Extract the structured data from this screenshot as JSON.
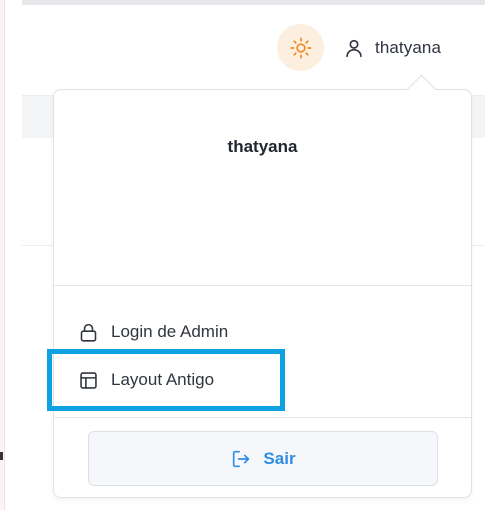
{
  "colors": {
    "accent": "#2f8de4",
    "highlight": "#0fa2e2",
    "theme_toggle_bg": "#fcefdf",
    "sun": "#f08a24"
  },
  "header": {
    "theme_toggle_icon": "sun-icon",
    "user_icon": "user-icon",
    "username": "thatyana"
  },
  "dropdown": {
    "user_name": "thatyana",
    "items": [
      {
        "icon": "lock-icon",
        "label": "Login de Admin"
      },
      {
        "icon": "layout-icon",
        "label": "Layout Antigo"
      }
    ],
    "logout": {
      "icon": "logout-icon",
      "label": "Sair"
    }
  }
}
